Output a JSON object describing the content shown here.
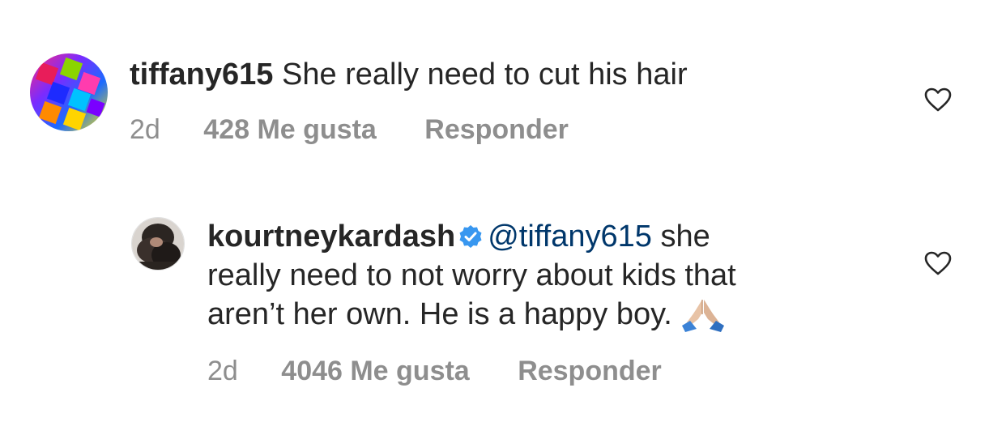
{
  "comments": [
    {
      "username": "tiffany615",
      "text": "She really need to cut his hair",
      "time": "2d",
      "likes": "428 Me gusta",
      "reply": "Responder"
    }
  ],
  "replies": [
    {
      "username": "kourtneykardash",
      "verified": true,
      "mention": "@tiffany615",
      "text_line1": "she",
      "text_line2": "really need to not worry about kids that",
      "text_line3": "aren’t her own. He is a happy boy.",
      "emoji": "folded-hands",
      "time": "2d",
      "likes": "4046 Me gusta",
      "reply": "Responder"
    }
  ],
  "colors": {
    "text": "#262626",
    "meta": "#8e8e8e",
    "mention": "#00376b",
    "verified": "#3897f0"
  }
}
